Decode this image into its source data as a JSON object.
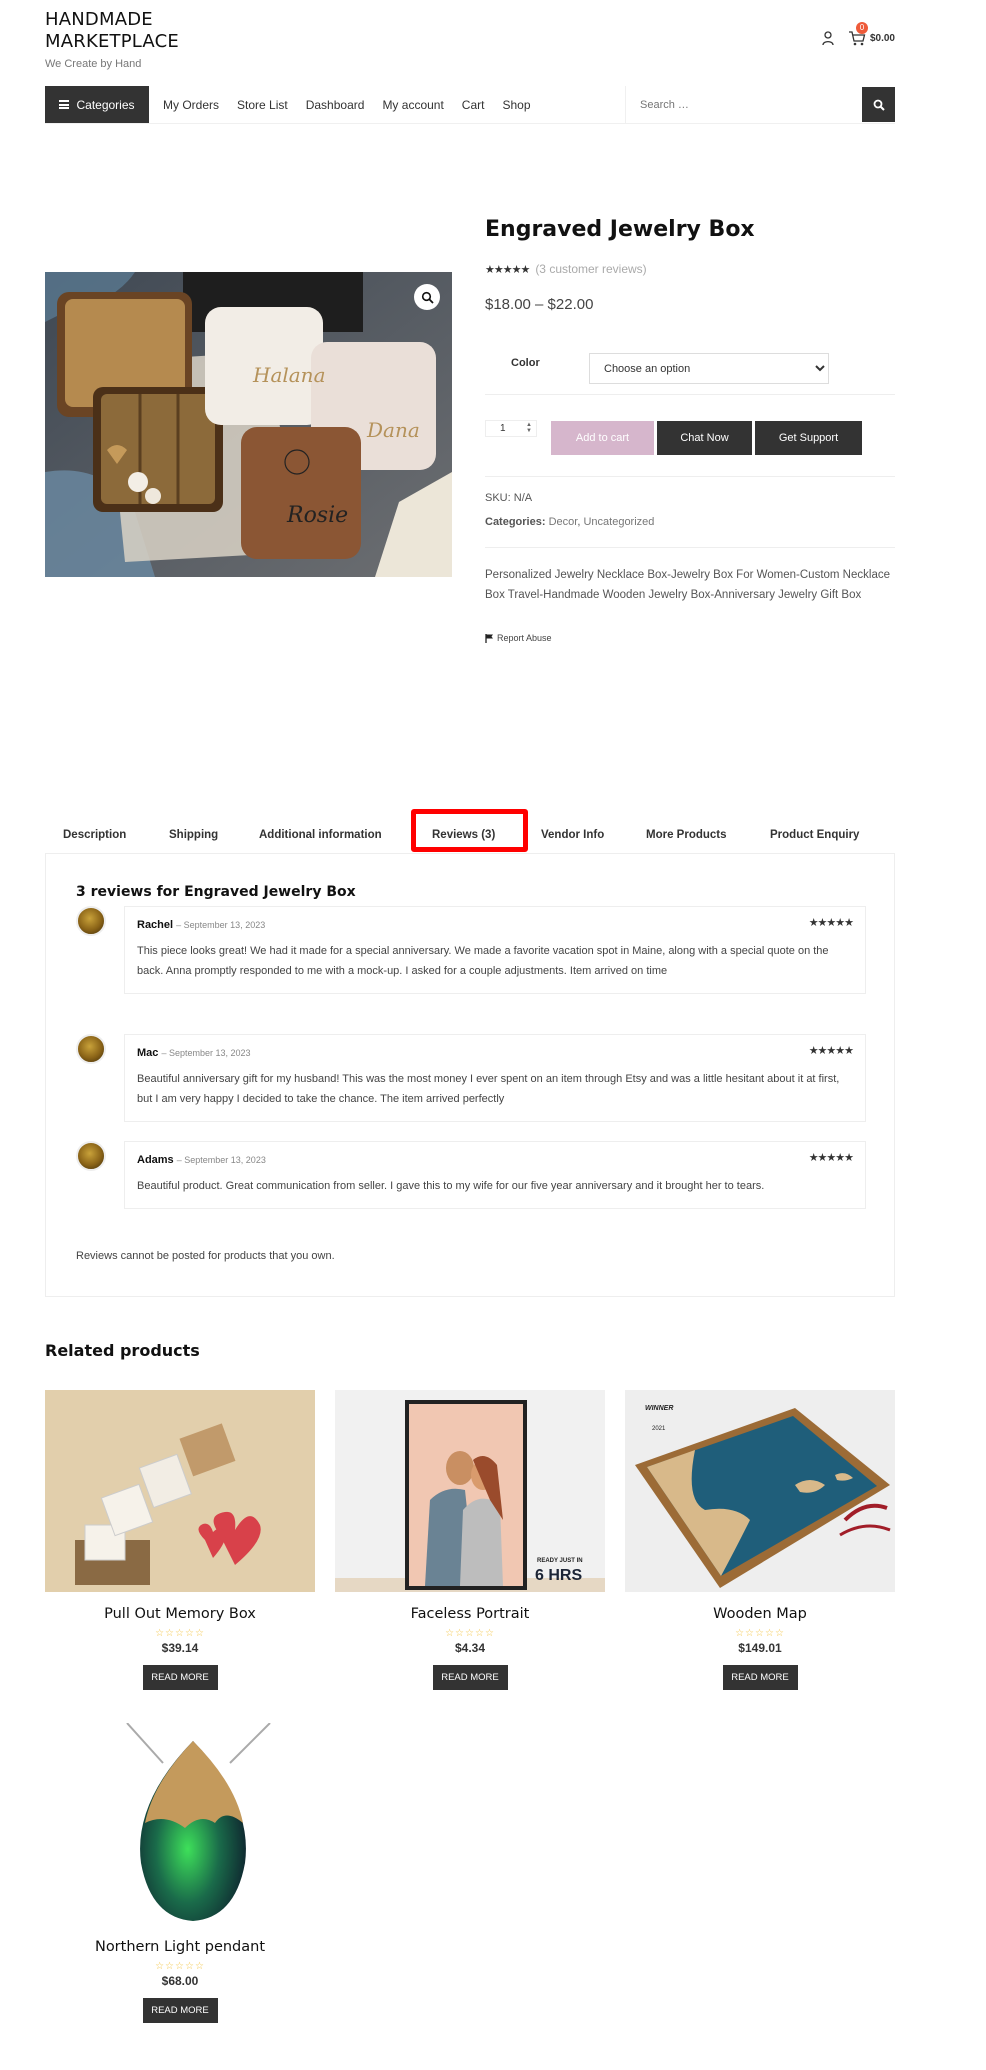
{
  "header": {
    "site_title_line1": "HANDMADE",
    "site_title_line2": "MARKETPLACE",
    "tagline": "We Create by Hand",
    "cart_count": "0",
    "cart_total": "$0.00",
    "icons": {
      "account": "user-icon",
      "cart": "cart-icon"
    }
  },
  "nav": {
    "categories_label": "Categories",
    "links": [
      "My Orders",
      "Store List",
      "Dashboard",
      "My account",
      "Cart",
      "Shop"
    ],
    "search_placeholder": "Search …",
    "search_icon": "search-icon"
  },
  "product": {
    "title": "Engraved Jewelry Box",
    "rating": 5,
    "rating_stars": "★★★★★",
    "review_link": "(3 customer reviews)",
    "price": "$18.00 – $22.00",
    "variation_label": "Color",
    "variation_value": "Choose an option",
    "quantity": "1",
    "add_to_cart": "Add to cart",
    "chat_now": "Chat Now",
    "get_support": "Get Support",
    "sku_label": "SKU:",
    "sku_value": "N/A",
    "categories_label": "Categories:",
    "categories": [
      "Decor",
      "Uncategorized"
    ],
    "description": "Personalized Jewelry Necklace Box-Jewelry Box For Women-Custom Necklace Box Travel-Handmade Wooden Jewelry Box-Anniversary Jewelry Gift Box",
    "report_abuse": "Report Abuse",
    "image_alt": "Engraved jewelry boxes with names Halana, Dana, Rosie"
  },
  "tabs": {
    "items": [
      "Description",
      "Shipping",
      "Additional information",
      "Reviews (3)",
      "Vendor Info",
      "More Products",
      "Product Enquiry"
    ],
    "active": "Reviews (3)"
  },
  "reviews": {
    "title": "3 reviews for Engraved Jewelry Box",
    "items": [
      {
        "author": "Rachel",
        "date": "September 13, 2023",
        "rating": 5,
        "stars": "★★★★★",
        "text": "This piece looks great! We had it made for a special anniversary. We made a favorite vacation spot in Maine, along with a special quote on the back. Anna promptly responded to me with a mock-up. I asked for a couple adjustments. Item arrived on time"
      },
      {
        "author": "Mac",
        "date": "September 13, 2023",
        "rating": 5,
        "stars": "★★★★★",
        "text": "Beautiful anniversary gift for my husband! This was the most money I ever spent on an item through Etsy and was a little hesitant about it at first, but I am very happy I decided to take the chance. The item arrived perfectly"
      },
      {
        "author": "Adams",
        "date": "September 13, 2023",
        "rating": 5,
        "stars": "★★★★★",
        "text": "Beautiful product. Great communication from seller. I gave this to my wife for our five year anniversary and it brought her to tears."
      }
    ],
    "notice": "Reviews cannot be posted for products that you own."
  },
  "related": {
    "title": "Related products",
    "products": [
      {
        "name": "Pull Out Memory Box",
        "price": "$39.14",
        "stars": "☆☆☆☆☆",
        "button": "READ MORE"
      },
      {
        "name": "Faceless Portrait",
        "price": "$4.34",
        "stars": "☆☆☆☆☆",
        "button": "READ MORE",
        "image_caption_small": "READY JUST IN",
        "image_caption_big": "6 HRS"
      },
      {
        "name": "Wooden Map",
        "price": "$149.01",
        "stars": "☆☆☆☆☆",
        "button": "READ MORE",
        "image_badge_top": "WINNER",
        "image_badge_year": "2021"
      },
      {
        "name": "Northern Light pendant",
        "price": "$68.00",
        "stars": "☆☆☆☆☆",
        "button": "READ MORE"
      }
    ]
  },
  "colors": {
    "dark": "#333333",
    "add_to_cart_bg": "#d6b6cc",
    "badge": "#ee5b3a",
    "highlight": "#ff0000",
    "star_empty": "#f3c64b"
  }
}
